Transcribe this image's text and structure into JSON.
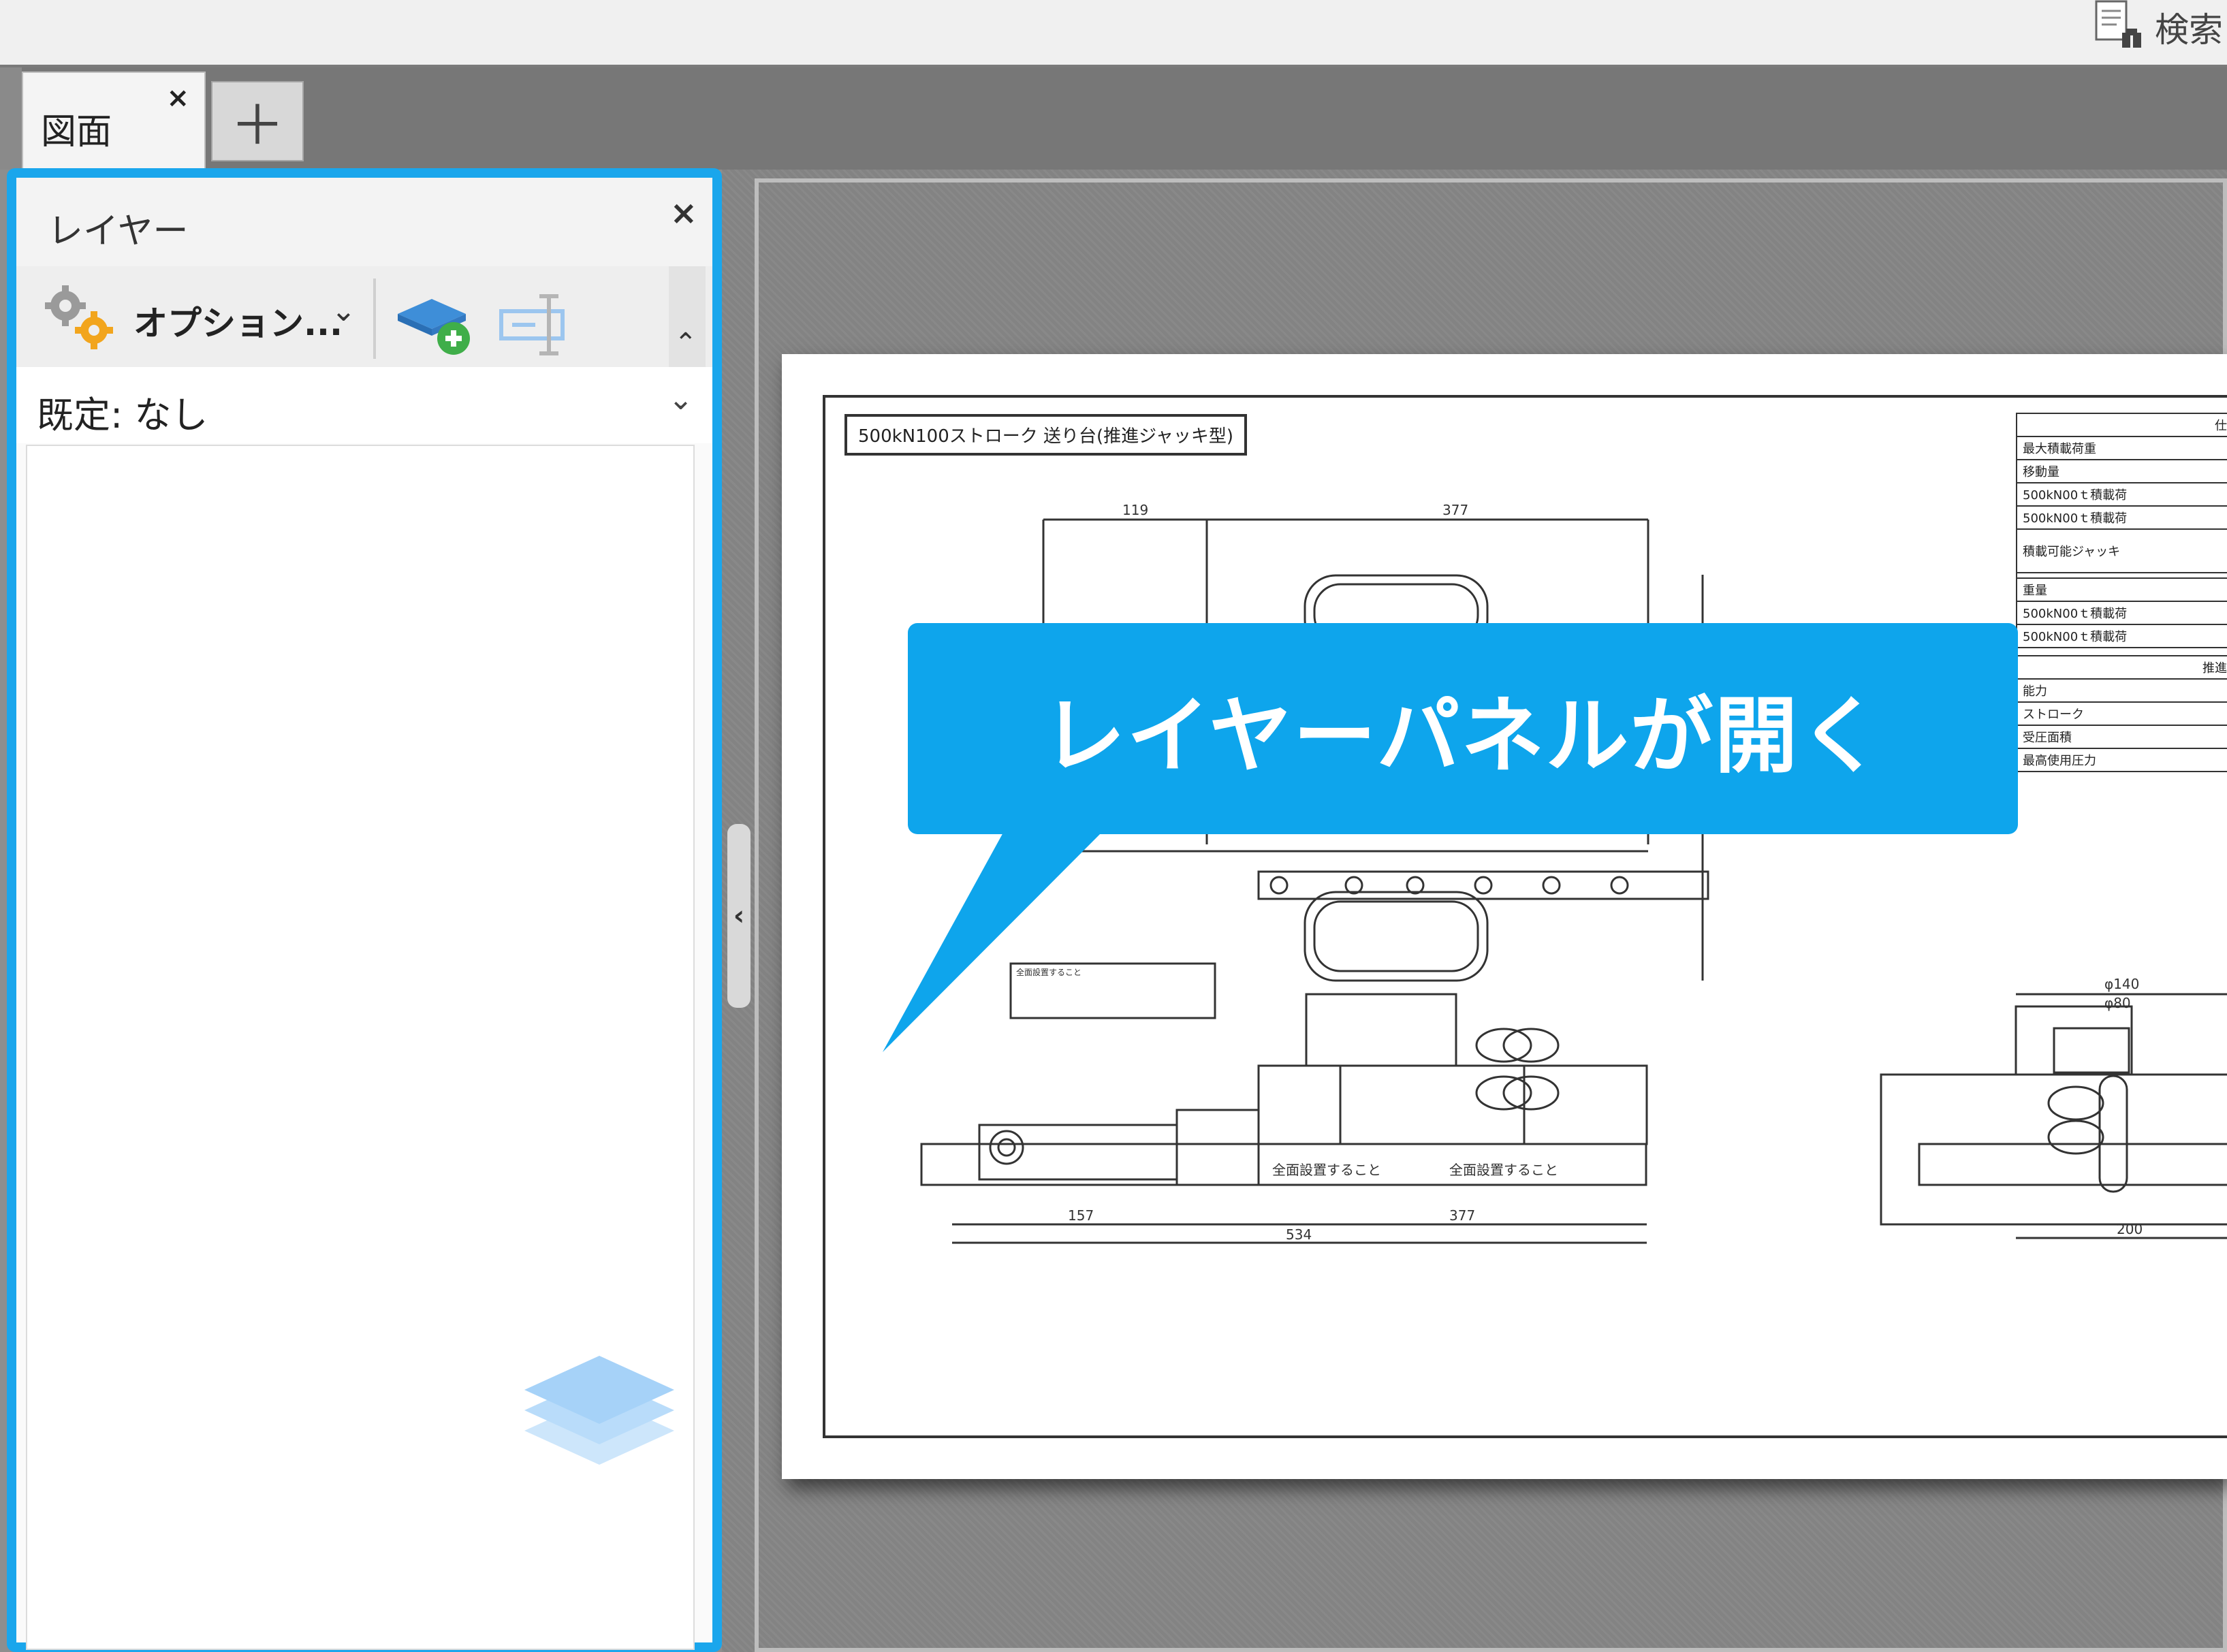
{
  "header": {
    "search_label": "検索"
  },
  "tabs": [
    {
      "label": "図面",
      "close": "×"
    }
  ],
  "add_tab_label": "＋",
  "layer_panel": {
    "title": "レイヤー",
    "close": "×",
    "options_label": "オプション...",
    "options_arrow": "⌄",
    "scroll_up": "⌃",
    "default_label": "既定: なし",
    "default_arrow": "⌄"
  },
  "collapse_handle": "‹",
  "drawing": {
    "title": "500kN100ストローク 送り台(推進ジャッキ型)",
    "spec_rows": [
      "仕",
      "最大積載荷重",
      "移動量",
      "500kN00ｔ積載荷",
      "500kN00ｔ積載荷",
      "積載可能ジャッキ",
      "",
      "重量",
      "500kN00ｔ積載荷",
      "500kN00ｔ積載荷",
      "",
      "推進",
      "能力",
      "ストローク",
      "受圧面積",
      "最高使用圧力"
    ],
    "dims_top": [
      "119",
      "377"
    ],
    "dims_bottom": [
      "157",
      "377",
      "534"
    ],
    "dims_right": [
      "φ140",
      "φ80",
      "200"
    ],
    "note_label": "全面設置すること"
  },
  "callout": {
    "text": "レイヤーパネルが開く",
    "color": "#0ea5ec"
  }
}
